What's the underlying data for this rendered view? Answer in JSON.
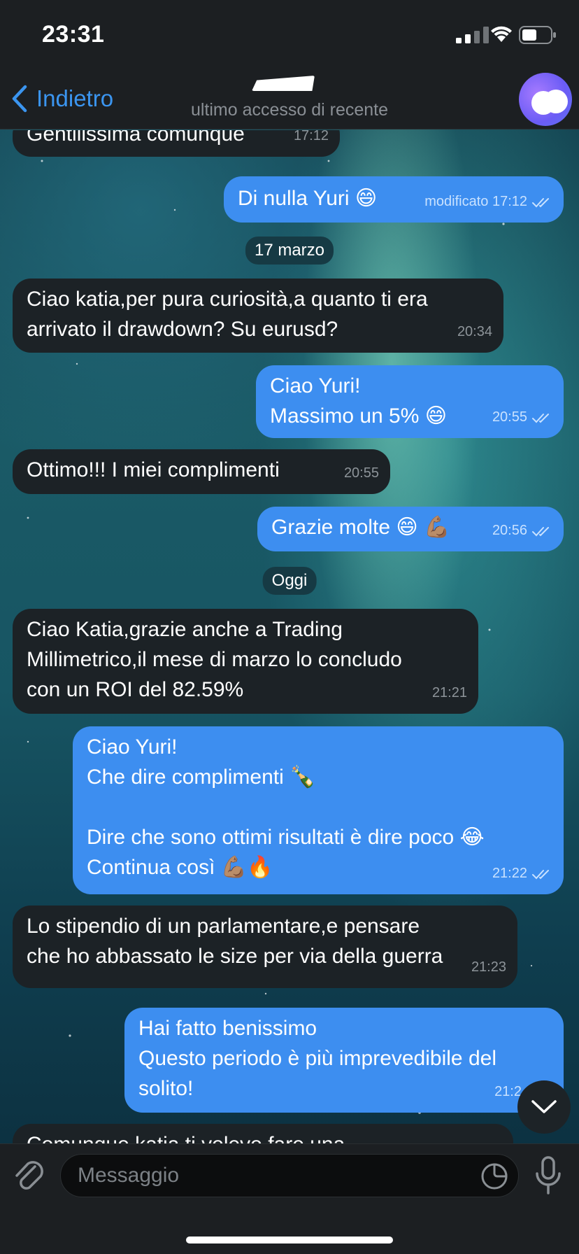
{
  "status_bar": {
    "time": "23:31"
  },
  "header": {
    "back_label": "Indietro",
    "subtitle": "ultimo accesso di recente"
  },
  "messages": [
    {
      "dir": "in",
      "text": "Gentilissima comunque",
      "time": "17:12"
    },
    {
      "dir": "out",
      "text": "Di nulla Yuri 😄",
      "time": "modificato 17:12"
    },
    {
      "date": "17 marzo"
    },
    {
      "dir": "in",
      "text": "Ciao katia,per pura curiosità,a quanto ti era\narrivato il drawdown? Su eurusd?",
      "time": "20:34"
    },
    {
      "dir": "out",
      "text": "Ciao Yuri!\nMassimo un 5% 😄",
      "time": "20:55"
    },
    {
      "dir": "in",
      "text": "Ottimo!!! I miei complimenti",
      "time": "20:55"
    },
    {
      "dir": "out",
      "text": "Grazie molte 😄 💪🏽",
      "time": "20:56"
    },
    {
      "date": "Oggi"
    },
    {
      "dir": "in",
      "text": "Ciao Katia,grazie anche a Trading\nMillimetrico,il mese di marzo lo concludo\ncon un ROI del 82.59%",
      "time": "21:21"
    },
    {
      "dir": "out",
      "text": "Ciao Yuri!\nChe dire complimenti 🍾\n\nDire che sono ottimi risultati è dire poco 😂\nContinua così 💪🏽🔥",
      "time": "21:22"
    },
    {
      "dir": "in",
      "text": "Lo stipendio di un parlamentare,e pensare\nche ho abbassato le size per via della guerra",
      "time": "21:23"
    },
    {
      "dir": "out",
      "text": "Hai fatto benissimo\nQuesto periodo è più imprevedibile del\nsolito!",
      "time": "21:2"
    },
    {
      "dir": "in",
      "text": "Comunque katia ti volevo fare una",
      "time": ""
    }
  ],
  "input": {
    "placeholder": "Messaggio"
  },
  "colors": {
    "accent": "#3b95f0",
    "outgoing": "#3d8ef0",
    "incoming": "#1c2226"
  },
  "icons": [
    "back-chevron-icon",
    "signal-icon",
    "wifi-icon",
    "battery-icon",
    "attach-icon",
    "sticker-icon",
    "mic-icon",
    "chevron-down-icon",
    "double-check-icon"
  ]
}
